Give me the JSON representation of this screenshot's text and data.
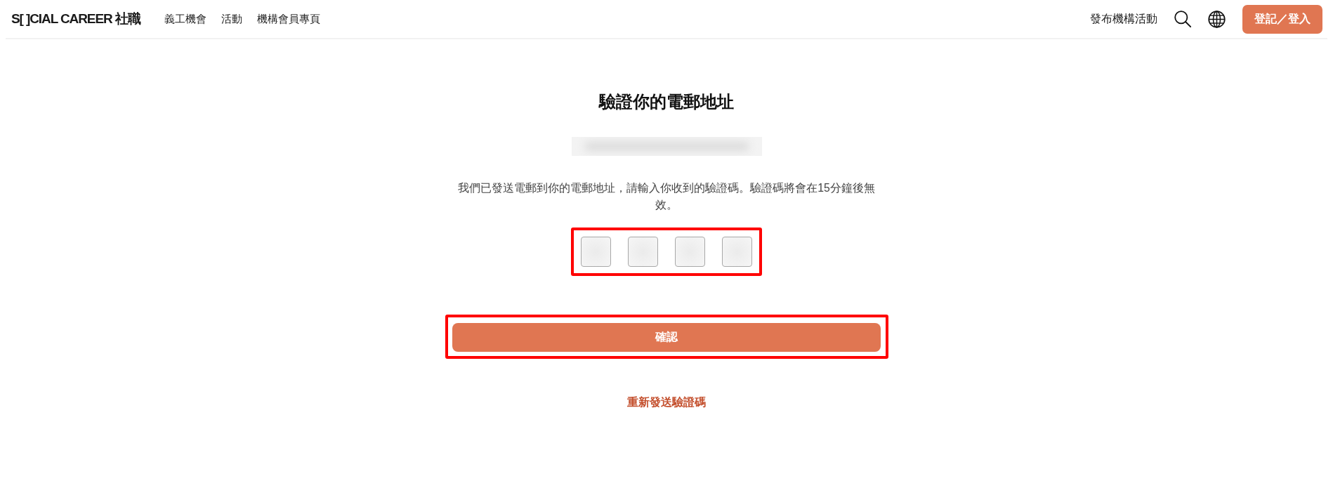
{
  "header": {
    "logo": "S[ ]CIAL CAREER 社職",
    "nav": [
      {
        "label": "義工機會"
      },
      {
        "label": "活動"
      },
      {
        "label": "機構會員專頁"
      }
    ],
    "post_event_link": "發布機構活動",
    "login_button": "登記／登入"
  },
  "verify": {
    "title": "驗證你的電郵地址",
    "email": {
      "redacted": true
    },
    "message": "我們已發送電郵到你的電郵地址，請輸入你收到的驗證碼。驗證碼將會在15分鐘後無效。",
    "code_input": {
      "highlighted": true,
      "boxes": [
        {
          "kind": "digit"
        },
        {
          "kind": "digit"
        },
        {
          "kind": "digit"
        },
        {
          "kind": "digit"
        }
      ]
    },
    "confirm_button": {
      "label": "確認",
      "highlighted": true
    },
    "resend_link": "重新發送驗證碼"
  }
}
